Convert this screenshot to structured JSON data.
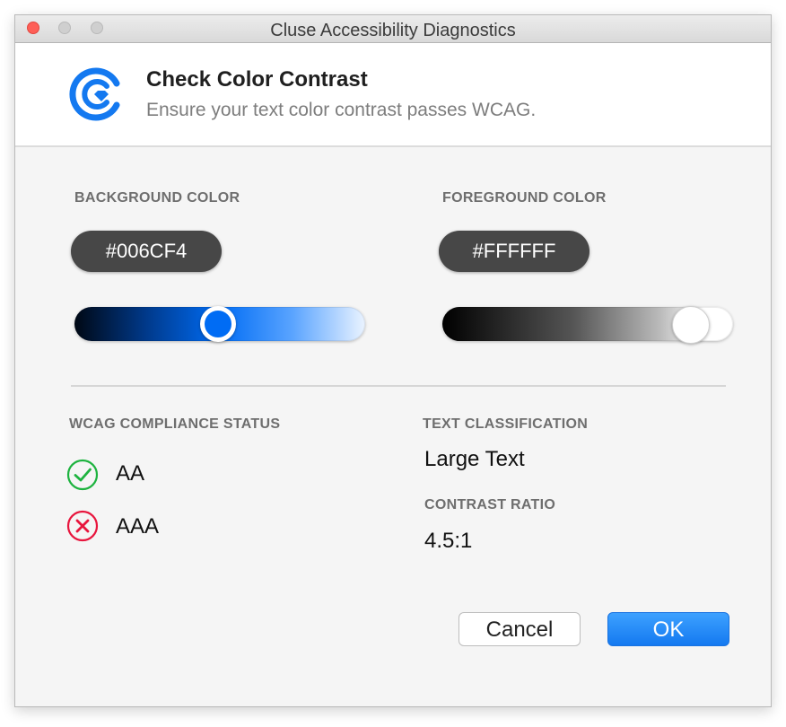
{
  "window": {
    "title": "Cluse Accessibility Diagnostics"
  },
  "header": {
    "logo_icon": "cluse-logo-icon",
    "title": "Check Color Contrast",
    "subtitle": "Ensure your text color contrast passes WCAG."
  },
  "background": {
    "label": "BACKGROUND COLOR",
    "hex_value": "#006CF4",
    "slider_position": 0.5,
    "color": "#006CF4"
  },
  "foreground": {
    "label": "FOREGROUND COLOR",
    "hex_value": "#FFFFFF",
    "slider_position": 0.9,
    "color": "#FFFFFF"
  },
  "compliance": {
    "label": "WCAG COMPLIANCE STATUS",
    "items": [
      {
        "level": "AA",
        "status": "pass",
        "icon": "check-circle-icon",
        "color": "#1db33f"
      },
      {
        "level": "AAA",
        "status": "fail",
        "icon": "x-circle-icon",
        "color": "#e8153d"
      }
    ]
  },
  "classification": {
    "label": "TEXT CLASSIFICATION",
    "value": "Large Text"
  },
  "contrast": {
    "label": "CONTRAST RATIO",
    "value": "4.5:1"
  },
  "buttons": {
    "cancel_label": "Cancel",
    "ok_label": "OK"
  },
  "colors": {
    "accent": "#1479f0",
    "pill": "#474747"
  }
}
